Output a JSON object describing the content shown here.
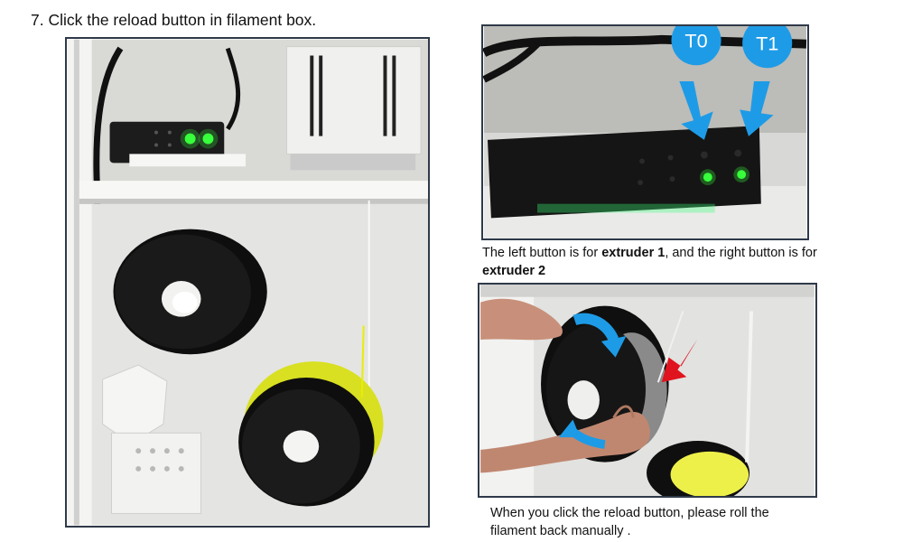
{
  "step": {
    "title": "7. Click the reload button in filament box."
  },
  "photos": {
    "buttons": {
      "label_t0": "T0",
      "label_t1": "T1"
    }
  },
  "captions": {
    "buttons": {
      "part1": "The left button is for ",
      "bold1": "extruder 1",
      "part2": ", and the right button is for ",
      "bold2": "extruder 2"
    },
    "manual": {
      "line1": "When you click the reload button, please roll the",
      "line2": "filament back manually ."
    }
  },
  "colors": {
    "badge_blue": "#1e9be6",
    "arrow_red": "#e0141e",
    "led_green": "#39ff3c",
    "frame": "#2f3a4a"
  }
}
